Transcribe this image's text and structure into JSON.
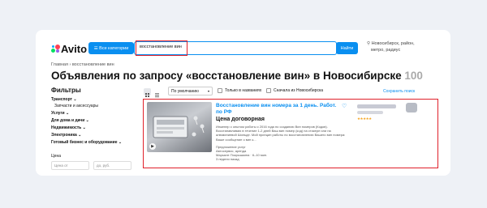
{
  "header": {
    "logo_text": "Avito",
    "categories_label": "☰ Все категории",
    "search_value": "восстановление вин",
    "find_label": "Найти",
    "location_line1": "Новосибирск, район,",
    "location_line2": "метро, радиус"
  },
  "breadcrumb": "Главная › восстановление вин",
  "page": {
    "title": "Объявления по запросу «восстановление вин» в Новосибирске",
    "count": "100"
  },
  "filters": {
    "heading": "Фильтры",
    "items": [
      "Транспорт ⌄",
      "Запчасти и аксессуары",
      "Услуги ⌄",
      "Для дома и дачи ⌄",
      "Недвижимость ⌄",
      "Электроника ⌄",
      "Готовый бизнес и оборудование ⌄"
    ],
    "price_label": "Цена",
    "price_from": "Цена от",
    "price_to": "до, руб."
  },
  "toolbar": {
    "sort_value": "По умолчанию",
    "only_titles": "Только в названиях",
    "novosibirsk_first": "Сначала из Новосибирска",
    "save_search": "Сохранить поиск"
  },
  "listing": {
    "title": "Восстановление вин номера за 1 день. Работ. по РФ",
    "price": "Цена договорная",
    "description": "Инженер с опытом работы с 2016 года по созданию Вин номеров (Кодов). Восстанавливаю в течение 1-2 дней Ваш вин номер (код) на стикере или на алюминиевой Шильде. Мой принцип работы по восстановлению Вашего вин номера: Ваше сообщение о вин к...",
    "meta1": "Предложение услуг",
    "meta2": "Автосервис, аренда",
    "meta3": "Марьяле Покрышкина · 6–10 мин.",
    "meta4": "3 недели назад",
    "stars": "★★★★★"
  },
  "colors": {
    "accent": "#0a8ff0",
    "highlight": "#e0202a"
  }
}
